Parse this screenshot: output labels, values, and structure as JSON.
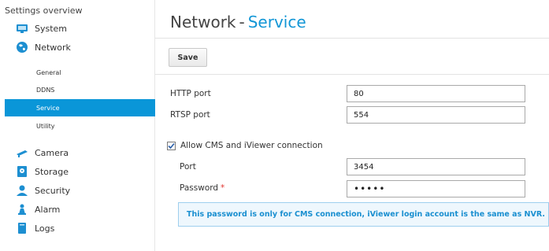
{
  "sidebar": {
    "title": "Settings overview",
    "items": [
      {
        "label": "System"
      },
      {
        "label": "Network"
      },
      {
        "label": "Camera"
      },
      {
        "label": "Storage"
      },
      {
        "label": "Security"
      },
      {
        "label": "Alarm"
      },
      {
        "label": "Logs"
      }
    ],
    "network_sub": [
      {
        "label": "General"
      },
      {
        "label": "DDNS"
      },
      {
        "label": "Service"
      },
      {
        "label": "Utility"
      }
    ]
  },
  "header": {
    "section": "Network",
    "separator": "-",
    "page": "Service"
  },
  "toolbar": {
    "save_label": "Save"
  },
  "form": {
    "http_port_label": "HTTP port",
    "http_port_value": "80",
    "rtsp_port_label": "RTSP port",
    "rtsp_port_value": "554",
    "allow_label": "Allow CMS and iViewer connection",
    "allow_checked": true,
    "port_label": "Port",
    "port_value": "3454",
    "password_label": "Password",
    "password_required_mark": "*",
    "password_value": "•••••"
  },
  "note": "This password is only for CMS connection, iViewer login account is the same as NVR.",
  "colors": {
    "accent": "#0a96d8",
    "title_accent": "#1296d6",
    "required": "#e0332d"
  },
  "icons": {
    "system": "monitor-icon",
    "network": "globe-icon",
    "camera": "camera-icon",
    "storage": "disk-icon",
    "security": "user-icon",
    "alarm": "alarm-icon",
    "logs": "book-icon"
  }
}
